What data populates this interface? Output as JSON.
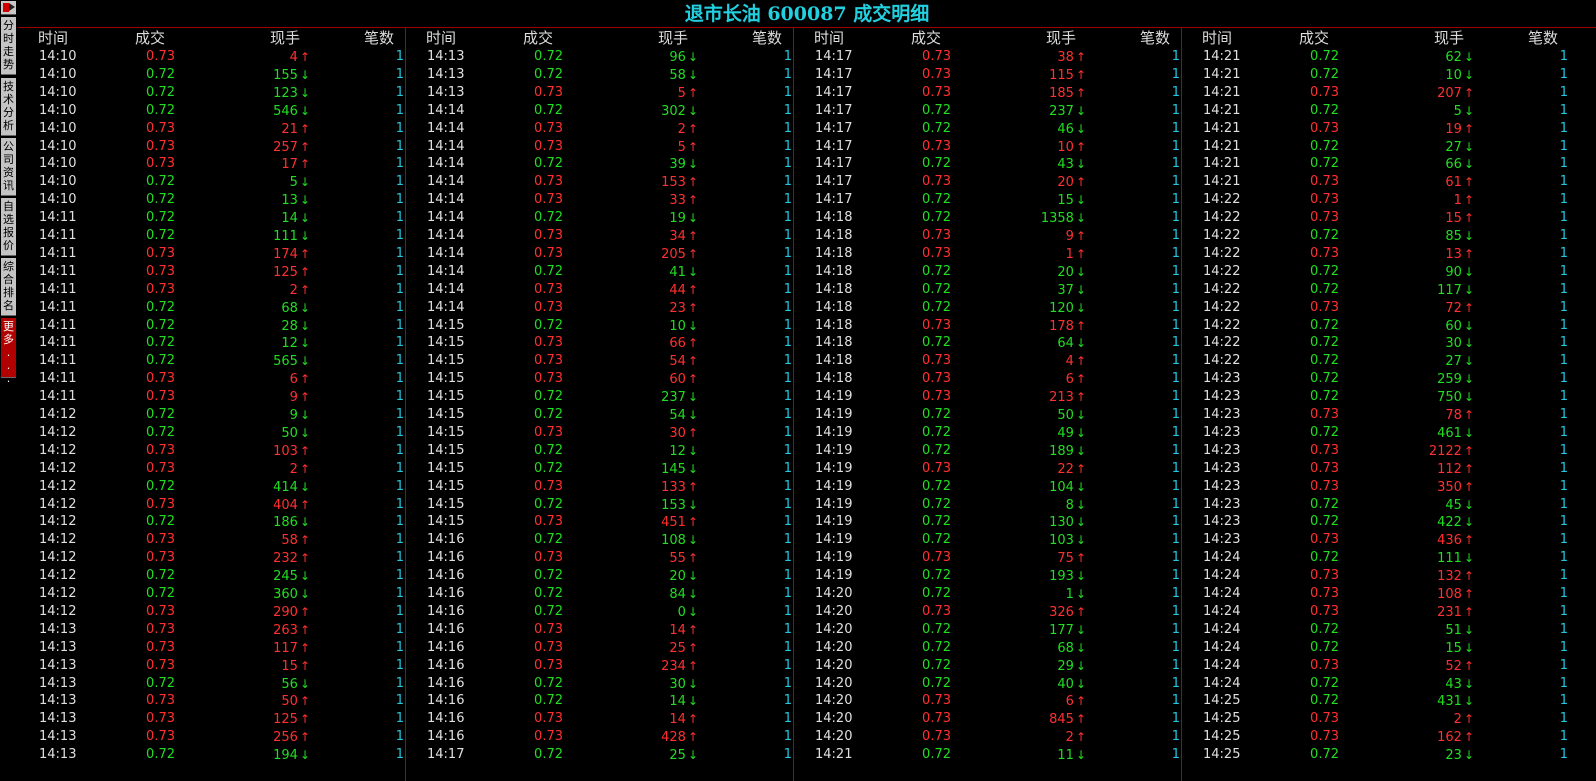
{
  "sidebar": {
    "tabs": [
      {
        "label": "分时走势"
      },
      {
        "label": "技术分析"
      },
      {
        "label": "公司资讯"
      },
      {
        "label": "自选报价"
      },
      {
        "label": "综合排名"
      },
      {
        "label": "更多..."
      }
    ]
  },
  "title": "退市长油 600087 成交明细",
  "headers": {
    "time": "时间",
    "price": "成交",
    "volume": "现手",
    "count": "笔数"
  },
  "colors": {
    "up": "#ff3030",
    "down": "#22dd22",
    "title": "#22d0e0",
    "count": "#22c8e0",
    "divider": "#b00000"
  },
  "columns": [
    [
      [
        "14:10",
        "0.73",
        "4",
        "u",
        "1"
      ],
      [
        "14:10",
        "0.72",
        "155",
        "d",
        "1"
      ],
      [
        "14:10",
        "0.72",
        "123",
        "d",
        "1"
      ],
      [
        "14:10",
        "0.72",
        "546",
        "d",
        "1"
      ],
      [
        "14:10",
        "0.73",
        "21",
        "u",
        "1"
      ],
      [
        "14:10",
        "0.73",
        "257",
        "u",
        "1"
      ],
      [
        "14:10",
        "0.73",
        "17",
        "u",
        "1"
      ],
      [
        "14:10",
        "0.72",
        "5",
        "d",
        "1"
      ],
      [
        "14:10",
        "0.72",
        "13",
        "d",
        "1"
      ],
      [
        "14:11",
        "0.72",
        "14",
        "d",
        "1"
      ],
      [
        "14:11",
        "0.72",
        "111",
        "d",
        "1"
      ],
      [
        "14:11",
        "0.73",
        "174",
        "u",
        "1"
      ],
      [
        "14:11",
        "0.73",
        "125",
        "u",
        "1"
      ],
      [
        "14:11",
        "0.73",
        "2",
        "u",
        "1"
      ],
      [
        "14:11",
        "0.72",
        "68",
        "d",
        "1"
      ],
      [
        "14:11",
        "0.72",
        "28",
        "d",
        "1"
      ],
      [
        "14:11",
        "0.72",
        "12",
        "d",
        "1"
      ],
      [
        "14:11",
        "0.72",
        "565",
        "d",
        "1"
      ],
      [
        "14:11",
        "0.73",
        "6",
        "u",
        "1"
      ],
      [
        "14:11",
        "0.73",
        "9",
        "u",
        "1"
      ],
      [
        "14:12",
        "0.72",
        "9",
        "d",
        "1"
      ],
      [
        "14:12",
        "0.72",
        "50",
        "d",
        "1"
      ],
      [
        "14:12",
        "0.73",
        "103",
        "u",
        "1"
      ],
      [
        "14:12",
        "0.73",
        "2",
        "u",
        "1"
      ],
      [
        "14:12",
        "0.72",
        "414",
        "d",
        "1"
      ],
      [
        "14:12",
        "0.73",
        "404",
        "u",
        "1"
      ],
      [
        "14:12",
        "0.72",
        "186",
        "d",
        "1"
      ],
      [
        "14:12",
        "0.73",
        "58",
        "u",
        "1"
      ],
      [
        "14:12",
        "0.73",
        "232",
        "u",
        "1"
      ],
      [
        "14:12",
        "0.72",
        "245",
        "d",
        "1"
      ],
      [
        "14:12",
        "0.72",
        "360",
        "d",
        "1"
      ],
      [
        "14:12",
        "0.73",
        "290",
        "u",
        "1"
      ],
      [
        "14:13",
        "0.73",
        "263",
        "u",
        "1"
      ],
      [
        "14:13",
        "0.73",
        "117",
        "u",
        "1"
      ],
      [
        "14:13",
        "0.73",
        "15",
        "u",
        "1"
      ],
      [
        "14:13",
        "0.72",
        "56",
        "d",
        "1"
      ],
      [
        "14:13",
        "0.73",
        "50",
        "u",
        "1"
      ],
      [
        "14:13",
        "0.73",
        "125",
        "u",
        "1"
      ],
      [
        "14:13",
        "0.73",
        "256",
        "u",
        "1"
      ],
      [
        "14:13",
        "0.72",
        "194",
        "d",
        "1"
      ]
    ],
    [
      [
        "14:13",
        "0.72",
        "96",
        "d",
        "1"
      ],
      [
        "14:13",
        "0.72",
        "58",
        "d",
        "1"
      ],
      [
        "14:13",
        "0.73",
        "5",
        "u",
        "1"
      ],
      [
        "14:14",
        "0.72",
        "302",
        "d",
        "1"
      ],
      [
        "14:14",
        "0.73",
        "2",
        "u",
        "1"
      ],
      [
        "14:14",
        "0.73",
        "5",
        "u",
        "1"
      ],
      [
        "14:14",
        "0.72",
        "39",
        "d",
        "1"
      ],
      [
        "14:14",
        "0.73",
        "153",
        "u",
        "1"
      ],
      [
        "14:14",
        "0.73",
        "33",
        "u",
        "1"
      ],
      [
        "14:14",
        "0.72",
        "19",
        "d",
        "1"
      ],
      [
        "14:14",
        "0.73",
        "34",
        "u",
        "1"
      ],
      [
        "14:14",
        "0.73",
        "205",
        "u",
        "1"
      ],
      [
        "14:14",
        "0.72",
        "41",
        "d",
        "1"
      ],
      [
        "14:14",
        "0.73",
        "44",
        "u",
        "1"
      ],
      [
        "14:14",
        "0.73",
        "23",
        "u",
        "1"
      ],
      [
        "14:15",
        "0.72",
        "10",
        "d",
        "1"
      ],
      [
        "14:15",
        "0.73",
        "66",
        "u",
        "1"
      ],
      [
        "14:15",
        "0.73",
        "54",
        "u",
        "1"
      ],
      [
        "14:15",
        "0.73",
        "60",
        "u",
        "1"
      ],
      [
        "14:15",
        "0.72",
        "237",
        "d",
        "1"
      ],
      [
        "14:15",
        "0.72",
        "54",
        "d",
        "1"
      ],
      [
        "14:15",
        "0.73",
        "30",
        "u",
        "1"
      ],
      [
        "14:15",
        "0.72",
        "12",
        "d",
        "1"
      ],
      [
        "14:15",
        "0.72",
        "145",
        "d",
        "1"
      ],
      [
        "14:15",
        "0.73",
        "133",
        "u",
        "1"
      ],
      [
        "14:15",
        "0.72",
        "153",
        "d",
        "1"
      ],
      [
        "14:15",
        "0.73",
        "451",
        "u",
        "1"
      ],
      [
        "14:16",
        "0.72",
        "108",
        "d",
        "1"
      ],
      [
        "14:16",
        "0.73",
        "55",
        "u",
        "1"
      ],
      [
        "14:16",
        "0.72",
        "20",
        "d",
        "1"
      ],
      [
        "14:16",
        "0.72",
        "84",
        "d",
        "1"
      ],
      [
        "14:16",
        "0.72",
        "0",
        "d",
        "1"
      ],
      [
        "14:16",
        "0.73",
        "14",
        "u",
        "1"
      ],
      [
        "14:16",
        "0.73",
        "25",
        "u",
        "1"
      ],
      [
        "14:16",
        "0.73",
        "234",
        "u",
        "1"
      ],
      [
        "14:16",
        "0.72",
        "30",
        "d",
        "1"
      ],
      [
        "14:16",
        "0.72",
        "14",
        "d",
        "1"
      ],
      [
        "14:16",
        "0.73",
        "14",
        "u",
        "1"
      ],
      [
        "14:16",
        "0.73",
        "428",
        "u",
        "1"
      ],
      [
        "14:17",
        "0.72",
        "25",
        "d",
        "1"
      ]
    ],
    [
      [
        "14:17",
        "0.73",
        "38",
        "u",
        "1"
      ],
      [
        "14:17",
        "0.73",
        "115",
        "u",
        "1"
      ],
      [
        "14:17",
        "0.73",
        "185",
        "u",
        "1"
      ],
      [
        "14:17",
        "0.72",
        "237",
        "d",
        "1"
      ],
      [
        "14:17",
        "0.72",
        "46",
        "d",
        "1"
      ],
      [
        "14:17",
        "0.73",
        "10",
        "u",
        "1"
      ],
      [
        "14:17",
        "0.72",
        "43",
        "d",
        "1"
      ],
      [
        "14:17",
        "0.73",
        "20",
        "u",
        "1"
      ],
      [
        "14:17",
        "0.72",
        "15",
        "d",
        "1"
      ],
      [
        "14:18",
        "0.72",
        "1358",
        "d",
        "1"
      ],
      [
        "14:18",
        "0.73",
        "9",
        "u",
        "1"
      ],
      [
        "14:18",
        "0.73",
        "1",
        "u",
        "1"
      ],
      [
        "14:18",
        "0.72",
        "20",
        "d",
        "1"
      ],
      [
        "14:18",
        "0.72",
        "37",
        "d",
        "1"
      ],
      [
        "14:18",
        "0.72",
        "120",
        "d",
        "1"
      ],
      [
        "14:18",
        "0.73",
        "178",
        "u",
        "1"
      ],
      [
        "14:18",
        "0.72",
        "64",
        "d",
        "1"
      ],
      [
        "14:18",
        "0.73",
        "4",
        "u",
        "1"
      ],
      [
        "14:18",
        "0.73",
        "6",
        "u",
        "1"
      ],
      [
        "14:19",
        "0.73",
        "213",
        "u",
        "1"
      ],
      [
        "14:19",
        "0.72",
        "50",
        "d",
        "1"
      ],
      [
        "14:19",
        "0.72",
        "49",
        "d",
        "1"
      ],
      [
        "14:19",
        "0.72",
        "189",
        "d",
        "1"
      ],
      [
        "14:19",
        "0.73",
        "22",
        "u",
        "1"
      ],
      [
        "14:19",
        "0.72",
        "104",
        "d",
        "1"
      ],
      [
        "14:19",
        "0.72",
        "8",
        "d",
        "1"
      ],
      [
        "14:19",
        "0.72",
        "130",
        "d",
        "1"
      ],
      [
        "14:19",
        "0.72",
        "103",
        "d",
        "1"
      ],
      [
        "14:19",
        "0.73",
        "75",
        "u",
        "1"
      ],
      [
        "14:19",
        "0.72",
        "193",
        "d",
        "1"
      ],
      [
        "14:20",
        "0.72",
        "1",
        "d",
        "1"
      ],
      [
        "14:20",
        "0.73",
        "326",
        "u",
        "1"
      ],
      [
        "14:20",
        "0.72",
        "177",
        "d",
        "1"
      ],
      [
        "14:20",
        "0.72",
        "68",
        "d",
        "1"
      ],
      [
        "14:20",
        "0.72",
        "29",
        "d",
        "1"
      ],
      [
        "14:20",
        "0.72",
        "40",
        "d",
        "1"
      ],
      [
        "14:20",
        "0.73",
        "6",
        "u",
        "1"
      ],
      [
        "14:20",
        "0.73",
        "845",
        "u",
        "1"
      ],
      [
        "14:20",
        "0.73",
        "2",
        "u",
        "1"
      ],
      [
        "14:21",
        "0.72",
        "11",
        "d",
        "1"
      ]
    ],
    [
      [
        "14:21",
        "0.72",
        "62",
        "d",
        "1"
      ],
      [
        "14:21",
        "0.72",
        "10",
        "d",
        "1"
      ],
      [
        "14:21",
        "0.73",
        "207",
        "u",
        "1"
      ],
      [
        "14:21",
        "0.72",
        "5",
        "d",
        "1"
      ],
      [
        "14:21",
        "0.73",
        "19",
        "u",
        "1"
      ],
      [
        "14:21",
        "0.72",
        "27",
        "d",
        "1"
      ],
      [
        "14:21",
        "0.72",
        "66",
        "d",
        "1"
      ],
      [
        "14:21",
        "0.73",
        "61",
        "u",
        "1"
      ],
      [
        "14:22",
        "0.73",
        "1",
        "u",
        "1"
      ],
      [
        "14:22",
        "0.73",
        "15",
        "u",
        "1"
      ],
      [
        "14:22",
        "0.72",
        "85",
        "d",
        "1"
      ],
      [
        "14:22",
        "0.73",
        "13",
        "u",
        "1"
      ],
      [
        "14:22",
        "0.72",
        "90",
        "d",
        "1"
      ],
      [
        "14:22",
        "0.72",
        "117",
        "d",
        "1"
      ],
      [
        "14:22",
        "0.73",
        "72",
        "u",
        "1"
      ],
      [
        "14:22",
        "0.72",
        "60",
        "d",
        "1"
      ],
      [
        "14:22",
        "0.72",
        "30",
        "d",
        "1"
      ],
      [
        "14:22",
        "0.72",
        "27",
        "d",
        "1"
      ],
      [
        "14:23",
        "0.72",
        "259",
        "d",
        "1"
      ],
      [
        "14:23",
        "0.72",
        "750",
        "d",
        "1"
      ],
      [
        "14:23",
        "0.73",
        "78",
        "u",
        "1"
      ],
      [
        "14:23",
        "0.72",
        "461",
        "d",
        "1"
      ],
      [
        "14:23",
        "0.73",
        "2122",
        "u",
        "1"
      ],
      [
        "14:23",
        "0.73",
        "112",
        "u",
        "1"
      ],
      [
        "14:23",
        "0.73",
        "350",
        "u",
        "1"
      ],
      [
        "14:23",
        "0.72",
        "45",
        "d",
        "1"
      ],
      [
        "14:23",
        "0.72",
        "422",
        "d",
        "1"
      ],
      [
        "14:23",
        "0.73",
        "436",
        "u",
        "1"
      ],
      [
        "14:24",
        "0.72",
        "111",
        "d",
        "1"
      ],
      [
        "14:24",
        "0.73",
        "132",
        "u",
        "1"
      ],
      [
        "14:24",
        "0.73",
        "108",
        "u",
        "1"
      ],
      [
        "14:24",
        "0.73",
        "231",
        "u",
        "1"
      ],
      [
        "14:24",
        "0.72",
        "51",
        "d",
        "1"
      ],
      [
        "14:24",
        "0.72",
        "15",
        "d",
        "1"
      ],
      [
        "14:24",
        "0.73",
        "52",
        "u",
        "1"
      ],
      [
        "14:24",
        "0.72",
        "43",
        "d",
        "1"
      ],
      [
        "14:25",
        "0.72",
        "431",
        "d",
        "1"
      ],
      [
        "14:25",
        "0.73",
        "2",
        "u",
        "1"
      ],
      [
        "14:25",
        "0.73",
        "162",
        "u",
        "1"
      ],
      [
        "14:25",
        "0.72",
        "23",
        "d",
        "1"
      ]
    ]
  ]
}
